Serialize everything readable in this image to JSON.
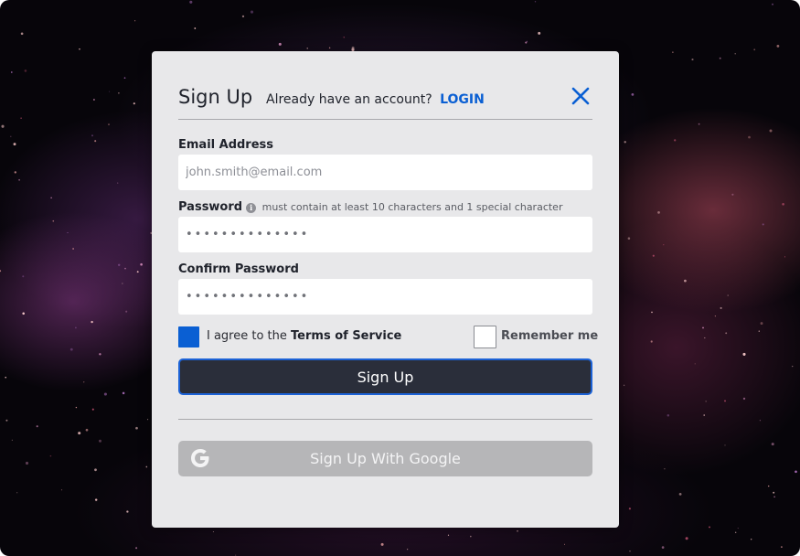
{
  "modal": {
    "title": "Sign Up",
    "subtitle": "Already have an account?",
    "login_link": "LOGIN"
  },
  "fields": {
    "email": {
      "label": "Email Address",
      "placeholder": "john.smith@email.com",
      "value": ""
    },
    "password": {
      "label": "Password",
      "hint": "must contain at least 10 characters and 1 special character",
      "value": "••••••••••••••"
    },
    "confirm_password": {
      "label": "Confirm Password",
      "value": "••••••••••••••"
    }
  },
  "options": {
    "agree_prefix": "I agree to the",
    "agree_link": "Terms of Service",
    "agree_checked": true,
    "remember_label": "Remember me",
    "remember_checked": false
  },
  "buttons": {
    "signup_label": "Sign Up",
    "google_label": "Sign Up With Google"
  },
  "icons": {
    "close": "close-icon",
    "info": "info-icon",
    "google": "google-logo-icon"
  },
  "colors": {
    "accent": "#0a5fd3",
    "button_dark": "#2a2e3a",
    "modal_bg": "#e8e8ea",
    "google_button": "#b6b6b8"
  }
}
